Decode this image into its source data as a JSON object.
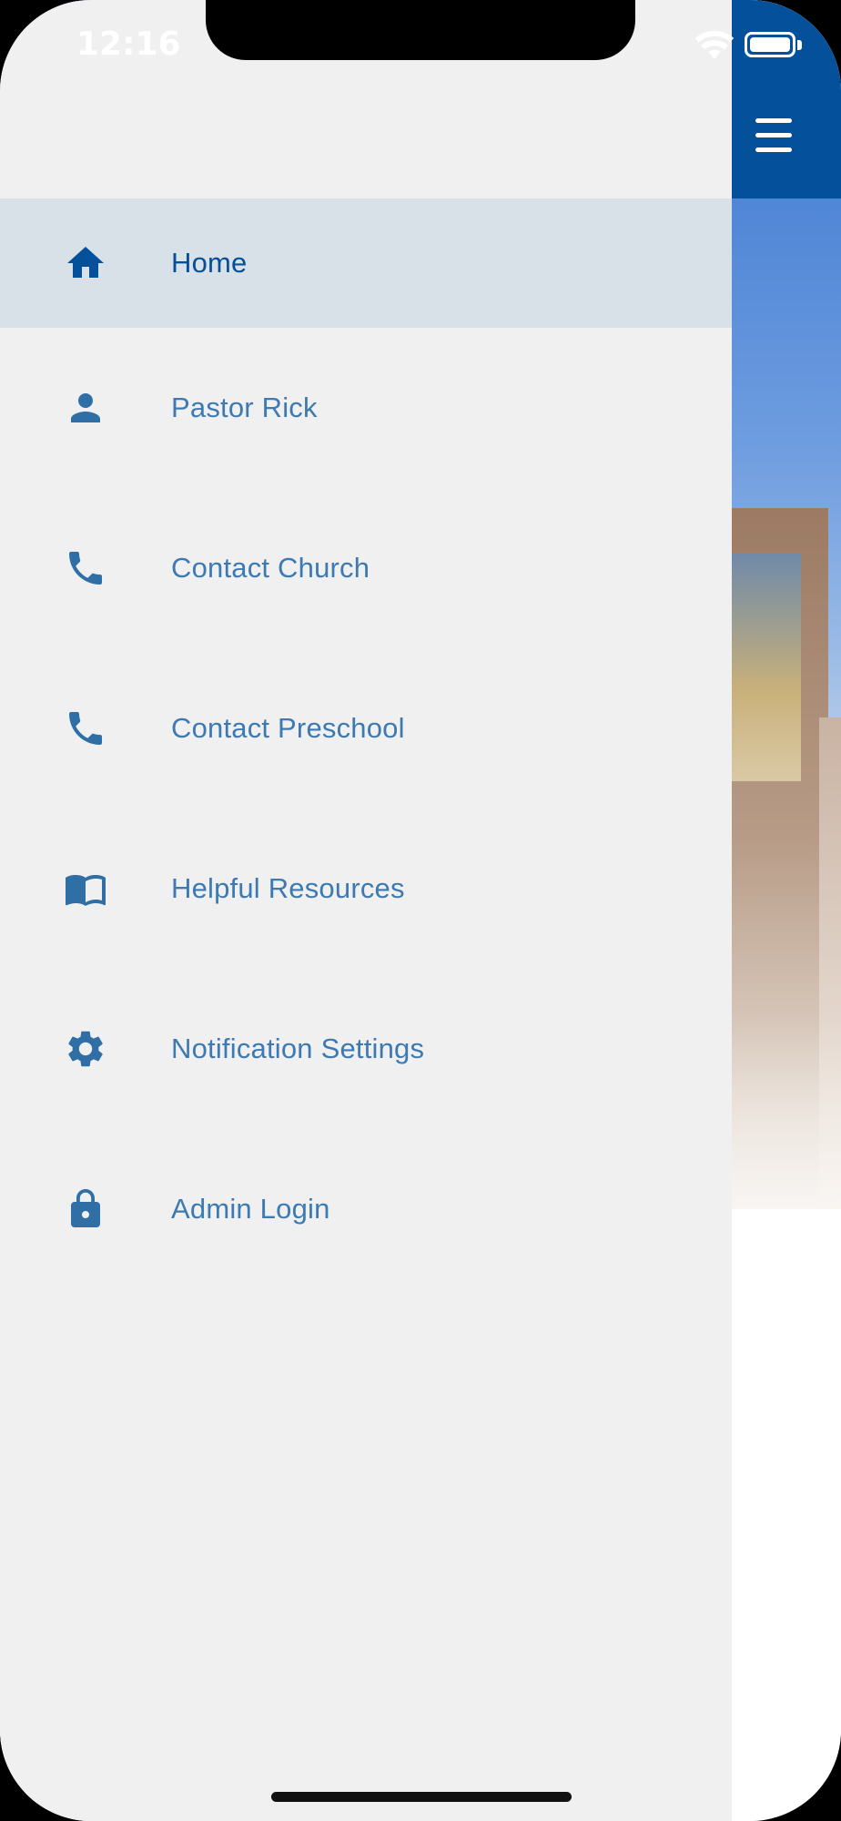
{
  "status_bar": {
    "time": "12:16"
  },
  "menu": {
    "items": [
      {
        "label": "Home",
        "icon": "home-icon",
        "selected": true
      },
      {
        "label": "Pastor Rick",
        "icon": "person-icon",
        "selected": false
      },
      {
        "label": "Contact Church",
        "icon": "phone-icon",
        "selected": false
      },
      {
        "label": "Contact Preschool",
        "icon": "phone-icon",
        "selected": false
      },
      {
        "label": "Helpful Resources",
        "icon": "book-icon",
        "selected": false
      },
      {
        "label": "Notification Settings",
        "icon": "gear-icon",
        "selected": false
      },
      {
        "label": "Admin Login",
        "icon": "lock-icon",
        "selected": false
      }
    ]
  },
  "colors": {
    "accent": "#05509a",
    "label": "#3d7ab1",
    "drawer_bg": "#f0f0f0",
    "selected_bg": "#d8e0e8"
  }
}
